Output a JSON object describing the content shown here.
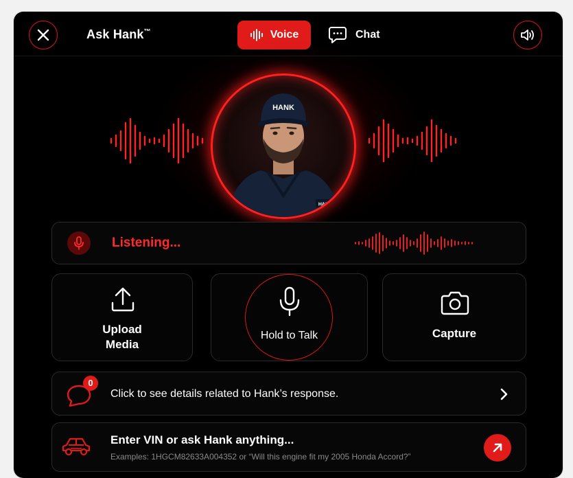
{
  "header": {
    "title": "Ask Hank",
    "title_mark": "™",
    "tabs": [
      {
        "label": "Voice",
        "active": true
      },
      {
        "label": "Chat",
        "active": false
      }
    ]
  },
  "hero": {
    "avatar_cap_text": "HANK",
    "avatar_badge_text": "HANK"
  },
  "listening": {
    "status": "Listening..."
  },
  "actions": {
    "upload_line1": "Upload",
    "upload_line2": "Media",
    "talk": "Hold to Talk",
    "capture": "Capture"
  },
  "details": {
    "badge_count": "0",
    "text": "Click to see details related to Hank’s response."
  },
  "vin": {
    "title": "Enter VIN or ask Hank anything...",
    "examples": "Examples: 1HGCM82633A004352 or “Will this engine fit my 2005 Honda Accord?”"
  },
  "colors": {
    "accent": "#e11a1a",
    "background": "#000000",
    "border": "#2a2a2a"
  }
}
